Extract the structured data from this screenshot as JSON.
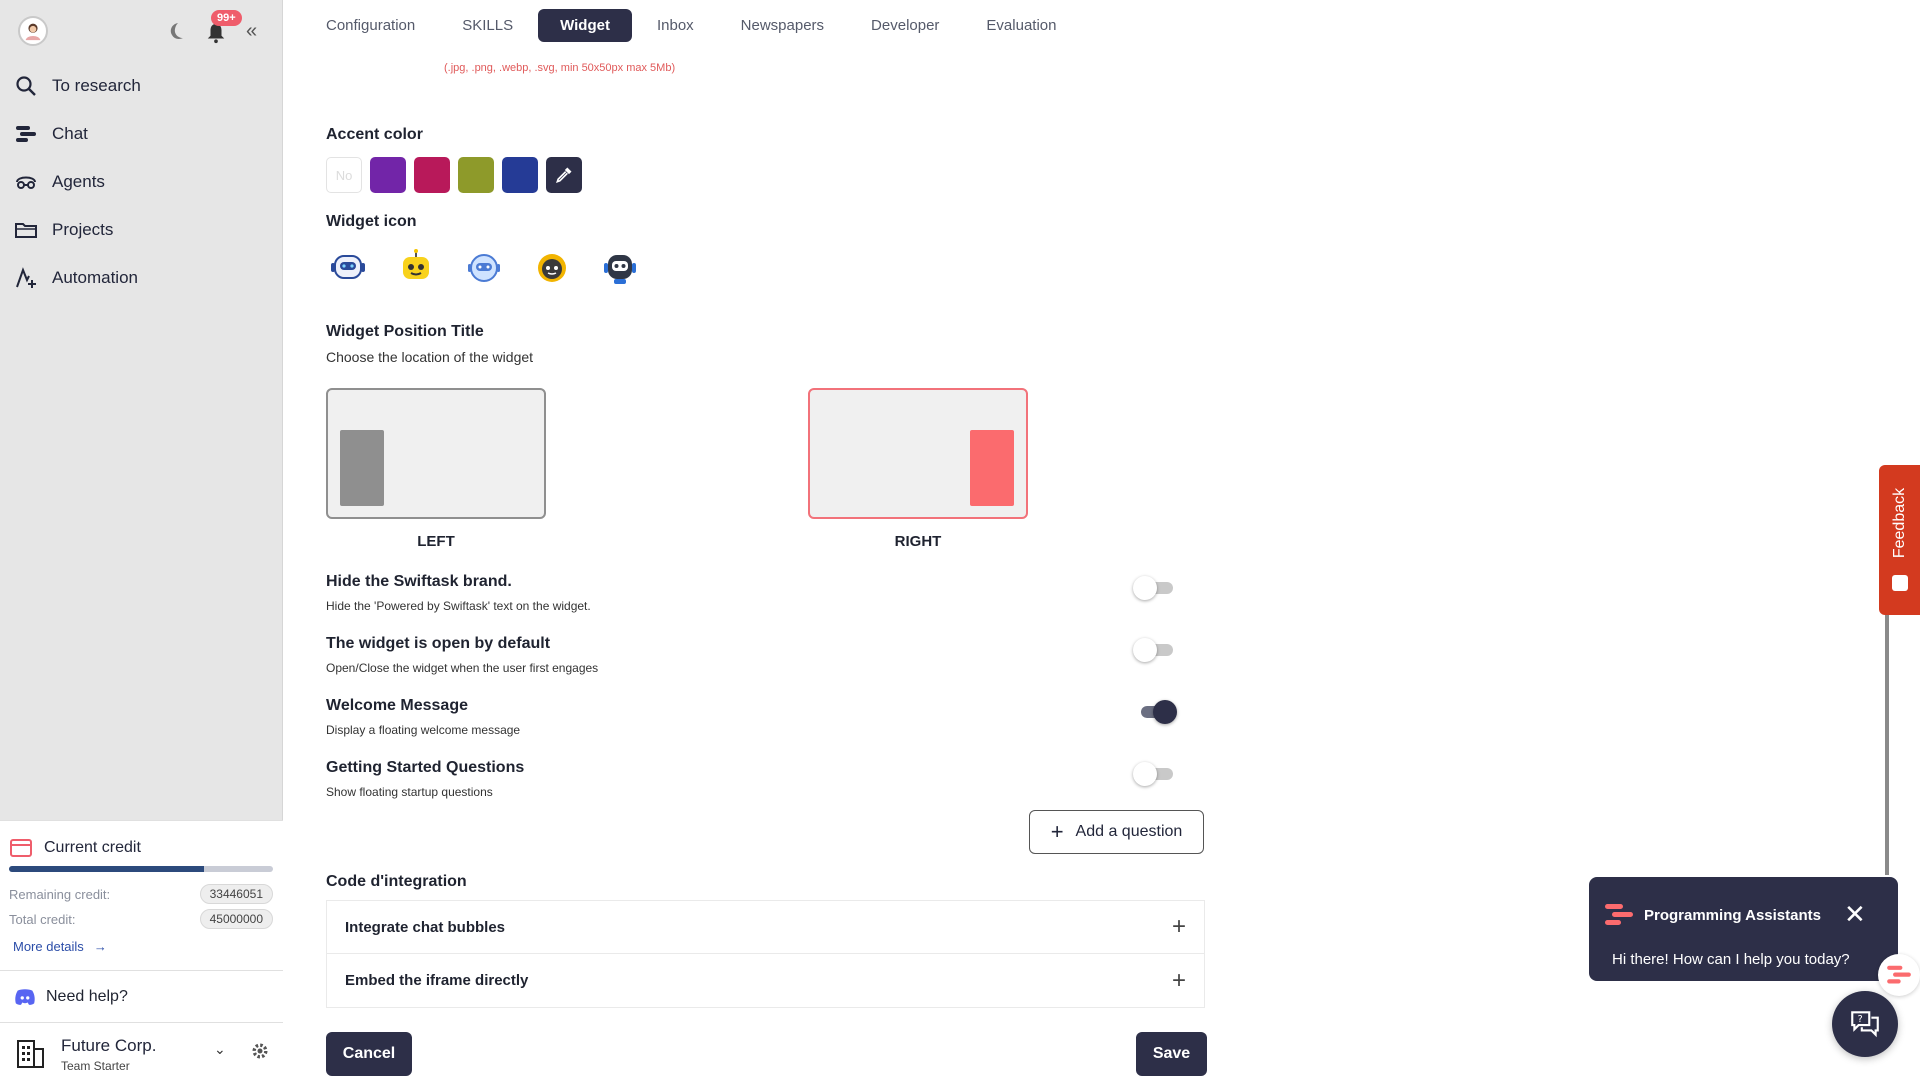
{
  "header": {
    "notification_count": "99+"
  },
  "sidebar": {
    "items": [
      {
        "label": "To research",
        "icon": "search-icon"
      },
      {
        "label": "Chat",
        "icon": "chat-icon"
      },
      {
        "label": "Agents",
        "icon": "agents-icon"
      },
      {
        "label": "Projects",
        "icon": "folder-icon"
      },
      {
        "label": "Automation",
        "icon": "automation-icon"
      }
    ],
    "credit": {
      "title": "Current credit",
      "remaining_label": "Remaining credit:",
      "remaining_value": "33446051",
      "total_label": "Total credit:",
      "total_value": "45000000",
      "used_fraction": 0.74,
      "more_details": "More details"
    },
    "help": "Need help?",
    "org": {
      "name": "Future Corp.",
      "plan": "Team Starter"
    }
  },
  "tabs": [
    "Configuration",
    "SKILLS",
    "Widget",
    "Inbox",
    "Newspapers",
    "Developer",
    "Evaluation"
  ],
  "active_tab": "Widget",
  "widget": {
    "file_hint": "(.jpg, .png, .webp, .svg, min 50x50px max 5Mb)",
    "accent_title": "Accent color",
    "accent_none": "No",
    "accent_colors": [
      "#7225a8",
      "#b8195a",
      "#8e9a2a",
      "#253b96"
    ],
    "icon_title": "Widget icon",
    "position_title": "Widget Position Title",
    "position_sub": "Choose the location of the widget",
    "position_left": "LEFT",
    "position_right": "RIGHT",
    "selected_position": "RIGHT",
    "options": [
      {
        "title": "Hide the Swiftask brand.",
        "sub": "Hide the 'Powered by Swiftask' text on the widget.",
        "on": false
      },
      {
        "title": "The widget is open by default",
        "sub": "Open/Close the widget when the user first engages",
        "on": false
      },
      {
        "title": "Welcome Message",
        "sub": "Display a floating welcome message",
        "on": true
      },
      {
        "title": "Getting Started Questions",
        "sub": "Show floating startup questions",
        "on": false
      }
    ],
    "add_question": "Add a question",
    "code_title": "Code d'integration",
    "accordion": [
      "Integrate chat bubbles",
      "Embed the iframe directly"
    ],
    "cancel": "Cancel",
    "save": "Save"
  },
  "feedback": "Feedback",
  "chat_popup": {
    "title": "Programming Assistants",
    "message": "Hi there! How can I help you today?"
  },
  "colors": {
    "primary": "#2d2f48",
    "accent_red": "#fb6b6e",
    "feedback": "#d33a1f"
  }
}
